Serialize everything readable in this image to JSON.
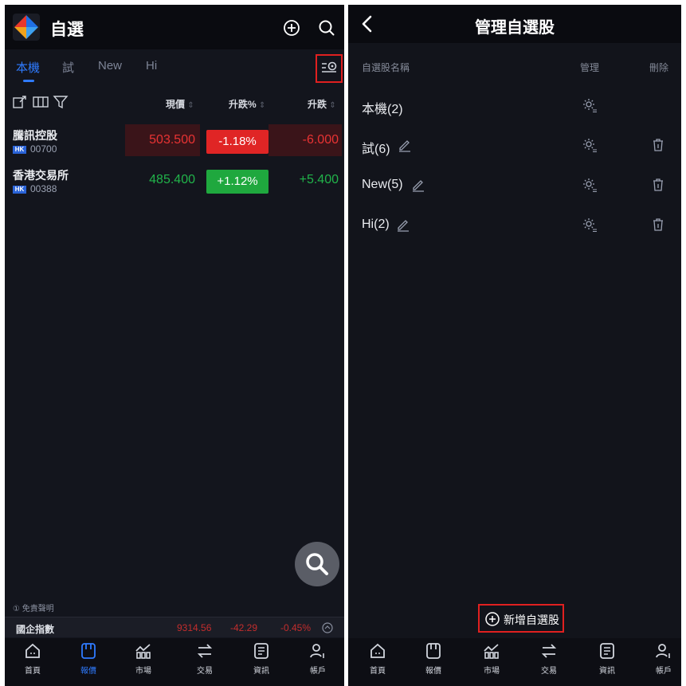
{
  "left": {
    "title": "自選",
    "tabs": [
      "本機",
      "試",
      "New",
      "Hi"
    ],
    "columns": {
      "price": "現價",
      "change_pct": "升跌%",
      "change": "升跌"
    },
    "sort_glyph": "⇕",
    "stocks": [
      {
        "name": "騰訊控股",
        "market": "HK",
        "code": "00700",
        "price": "503.500",
        "change_pct": "-1.18%",
        "change": "-6.000",
        "direction": "down"
      },
      {
        "name": "香港交易所",
        "market": "HK",
        "code": "00388",
        "price": "485.400",
        "change_pct": "+1.12%",
        "change": "+5.400",
        "direction": "up"
      }
    ],
    "disclaimer": "① 免責聲明",
    "index_bar": {
      "name": "國企指數",
      "value": "9314.56",
      "change": "-42.29",
      "change_pct": "-0.45%"
    }
  },
  "right": {
    "title": "管理自選股",
    "headers": {
      "name": "自選股名稱",
      "manage": "管理",
      "delete": "刪除"
    },
    "watchlists": [
      {
        "name": "本機(2)",
        "editable": false,
        "deletable": false
      },
      {
        "name": "試(6)",
        "editable": true,
        "deletable": true
      },
      {
        "name": "New(5)",
        "editable": true,
        "deletable": true
      },
      {
        "name": "Hi(2)",
        "editable": true,
        "deletable": true
      }
    ],
    "add_label": "新增自選股"
  },
  "nav": [
    "首頁",
    "報價",
    "市場",
    "交易",
    "資訊",
    "帳戶"
  ],
  "nav_active_left": 1,
  "icons": [
    "app-logo-icon",
    "add-circle-icon",
    "search-icon",
    "watchlist-settings-icon",
    "export-icon",
    "columns-icon",
    "filter-icon",
    "gear-icon",
    "pencil-icon",
    "trash-icon",
    "back-chevron-icon",
    "home-icon",
    "quote-icon",
    "market-icon",
    "trade-icon",
    "news-icon",
    "account-icon"
  ],
  "colors": {
    "accent": "#2f7bff",
    "up": "#21b34a",
    "down": "#e83333",
    "highlight_box": "#e02020"
  }
}
